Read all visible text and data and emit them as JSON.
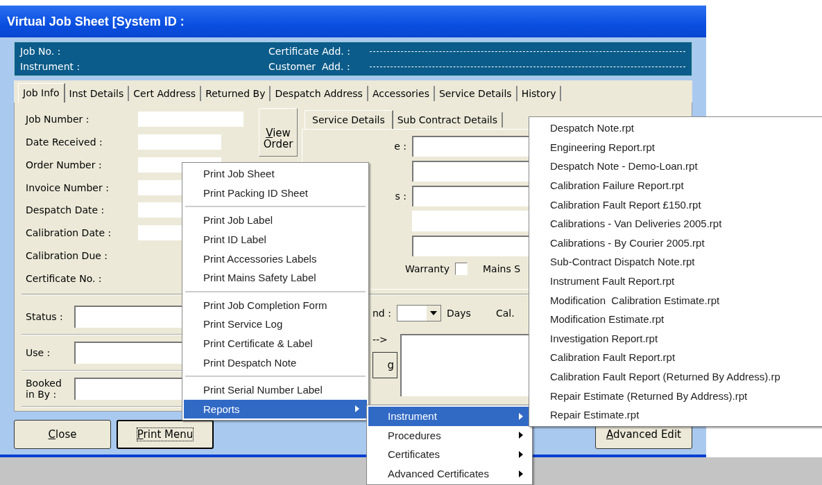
{
  "window": {
    "title": "Virtual Job Sheet [System ID :"
  },
  "header": {
    "left": [
      "Job No. :",
      "Instrument :"
    ],
    "right": [
      "Certificate Add. :",
      "Customer  Add. :"
    ]
  },
  "tabs": [
    {
      "label": "Job Info",
      "selected": true
    },
    {
      "label": "Inst Details",
      "selected": false
    },
    {
      "label": "Cert Address",
      "selected": false
    },
    {
      "label": "Returned By",
      "selected": false
    },
    {
      "label": "Despatch Address",
      "selected": false
    },
    {
      "label": "Accessories",
      "selected": false
    },
    {
      "label": "Service Details",
      "selected": false
    },
    {
      "label": "History",
      "selected": false
    }
  ],
  "job_fields": [
    {
      "label": "Job Number :",
      "kind": "wide"
    },
    {
      "label": "Date Received :",
      "kind": "field"
    },
    {
      "label": "Order Number :",
      "kind": "field"
    },
    {
      "label": "Invoice Number :",
      "kind": "field"
    },
    {
      "label": "Despatch Date :",
      "kind": "field"
    },
    {
      "label": "Calibration Date :",
      "kind": "field"
    },
    {
      "label": "Calibration Due :",
      "kind": "none"
    },
    {
      "label": "Certificate No. :",
      "kind": "none"
    }
  ],
  "view_order_button": {
    "label": "View Order"
  },
  "sub_tabs": [
    {
      "label": "Service Details",
      "selected": true
    },
    {
      "label": "Sub Contract Details",
      "selected": false
    }
  ],
  "service_fields": [
    {
      "kind": "labeled",
      "label": "e :"
    },
    {
      "kind": "plain"
    },
    {
      "kind": "labeled",
      "label": "s :"
    },
    {
      "kind": "flat"
    },
    {
      "kind": "plain"
    }
  ],
  "warranty": {
    "label": "Warranty",
    "checked": false
  },
  "mains_label": "Mains S",
  "lower_fields": [
    {
      "label": "Status :"
    },
    {
      "label": "Use :"
    },
    {
      "label": "Booked in By :"
    }
  ],
  "period": {
    "label": "nd :",
    "unit": "Days",
    "cal_label": "Cal."
  },
  "arrow_label": "-->",
  "partial_button": {
    "label": "g"
  },
  "buttons": [
    {
      "label": "Close",
      "kind": "left",
      "focused": false
    },
    {
      "label": "Print Menu",
      "kind": "left",
      "focused": true
    },
    {
      "label": "Advanced Edit",
      "kind": "right",
      "focused": false
    }
  ],
  "print_menu": {
    "groups": [
      [
        {
          "label": "Print Job Sheet",
          "selected": false
        },
        {
          "label": "Print Packing ID Sheet",
          "selected": false
        }
      ],
      [
        {
          "label": "Print Job Label",
          "selected": false
        },
        {
          "label": "Print ID Label",
          "selected": false
        },
        {
          "label": "Print Accessories Labels",
          "selected": false
        },
        {
          "label": "Print Mains Safety Label",
          "selected": false
        }
      ],
      [
        {
          "label": "Print Job Completion Form",
          "selected": false
        },
        {
          "label": "Print Service Log",
          "selected": false
        },
        {
          "label": "Print Certificate & Label",
          "selected": false
        },
        {
          "label": "Print Despatch Note",
          "selected": false
        }
      ],
      [
        {
          "label": "Print Serial Number Label",
          "selected": false
        },
        {
          "label": "Reports",
          "selected": true,
          "submenu": true
        }
      ]
    ]
  },
  "reports_menu": {
    "items": [
      {
        "label": "Instrument",
        "selected": true,
        "submenu": true
      },
      {
        "label": "Procedures",
        "selected": false,
        "submenu": true
      },
      {
        "label": "Certificates",
        "selected": false,
        "submenu": true
      },
      {
        "label": "Advanced Certificates",
        "selected": false,
        "submenu": true
      }
    ]
  },
  "instrument_menu": {
    "items": [
      {
        "label": "Despatch Note.rpt",
        "selected": false
      },
      {
        "label": "Engineering Report.rpt",
        "selected": false
      },
      {
        "label": "Despatch Note - Demo-Loan.rpt",
        "selected": false
      },
      {
        "label": "Calibration Failure Report.rpt",
        "selected": false
      },
      {
        "label": "Calibration Fault Report £150.rpt",
        "selected": false
      },
      {
        "label": "Calibrations - Van Deliveries 2005.rpt",
        "selected": false
      },
      {
        "label": "Calibrations - By Courier 2005.rpt",
        "selected": false
      },
      {
        "label": "Sub-Contract Dispatch Note.rpt",
        "selected": false
      },
      {
        "label": "Instrument Fault Report.rpt",
        "selected": false
      },
      {
        "label": "Modification  Calibration Estimate.rpt",
        "selected": false
      },
      {
        "label": "Modification Estimate.rpt",
        "selected": false
      },
      {
        "label": "Investigation Report.rpt",
        "selected": false
      },
      {
        "label": "Calibration Fault Report.rpt",
        "selected": false
      },
      {
        "label": "Calibration Fault Report (Returned By Address).rp",
        "selected": false
      },
      {
        "label": "Repair Estimate (Returned By Address).rpt",
        "selected": false
      },
      {
        "label": "Repair Estimate.rpt",
        "selected": false
      }
    ]
  }
}
